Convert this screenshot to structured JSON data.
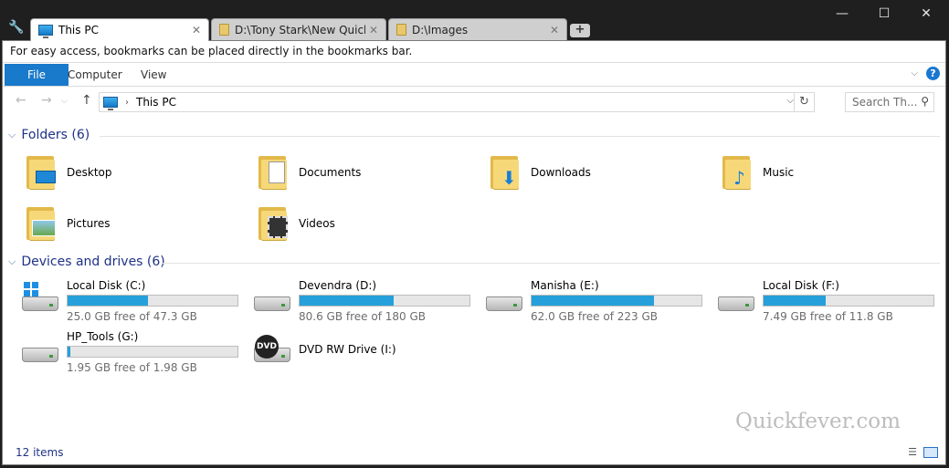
{
  "window": {
    "tabs": [
      {
        "label": "This PC",
        "icon": "this-pc-icon",
        "active": true
      },
      {
        "label": "D:\\Tony Stark\\New Quickfe",
        "icon": "folder-icon",
        "active": false
      },
      {
        "label": "D:\\Images",
        "icon": "folder-icon",
        "active": false
      }
    ],
    "new_tab_glyph": "+",
    "controls": {
      "minimize": "—",
      "maximize": "☐",
      "close": "✕"
    }
  },
  "bookmarks_bar": {
    "text": "For easy access, bookmarks can be placed directly in the bookmarks bar."
  },
  "ribbon": {
    "tabs": [
      "File",
      "Computer",
      "View"
    ],
    "help": "?",
    "accent": "#1979ca"
  },
  "navigation": {
    "breadcrumb": [
      "This PC"
    ],
    "search_placeholder": "Search Th..."
  },
  "folders": {
    "title": "Folders (6)",
    "items": [
      {
        "label": "Desktop",
        "icon": "desktop-folder-icon"
      },
      {
        "label": "Documents",
        "icon": "documents-folder-icon"
      },
      {
        "label": "Downloads",
        "icon": "downloads-folder-icon"
      },
      {
        "label": "Music",
        "icon": "music-folder-icon"
      },
      {
        "label": "Pictures",
        "icon": "pictures-folder-icon"
      },
      {
        "label": "Videos",
        "icon": "videos-folder-icon"
      }
    ]
  },
  "devices": {
    "title": "Devices and drives (6)",
    "drives": [
      {
        "name": "Local Disk (C:)",
        "free": "25.0 GB free of 47.3 GB",
        "used_fraction": 0.471,
        "icon": "windows-drive-icon"
      },
      {
        "name": "Devendra (D:)",
        "free": "80.6 GB free of 180 GB",
        "used_fraction": 0.552,
        "icon": "hard-drive-icon"
      },
      {
        "name": "Manisha (E:)",
        "free": "62.0 GB free of 223 GB",
        "used_fraction": 0.722,
        "icon": "hard-drive-icon"
      },
      {
        "name": "Local Disk (F:)",
        "free": "7.49 GB free of 11.8 GB",
        "used_fraction": 0.365,
        "icon": "hard-drive-icon"
      },
      {
        "name": "HP_Tools (G:)",
        "free": "1.95 GB free of 1.98 GB",
        "used_fraction": 0.015,
        "icon": "hard-drive-icon"
      }
    ],
    "optical": {
      "name": "DVD RW Drive (I:)",
      "badge": "DVD",
      "icon": "dvd-drive-icon"
    }
  },
  "status": {
    "items": "12 items"
  },
  "watermark": "Quickfever.com"
}
